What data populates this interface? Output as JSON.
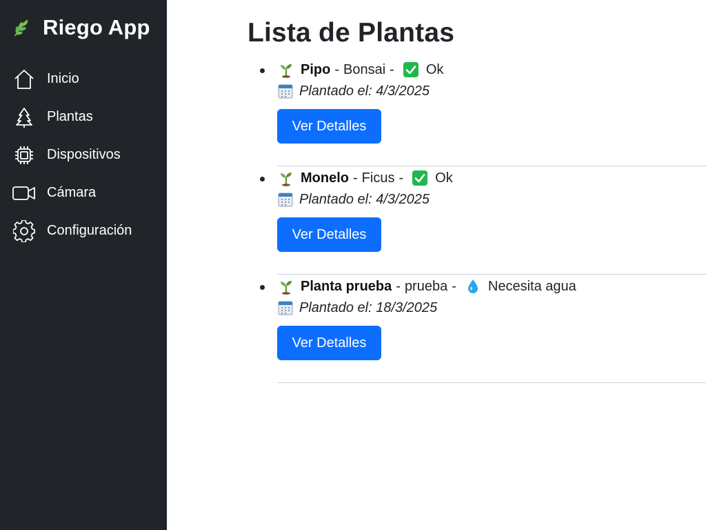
{
  "app": {
    "title": "Riego App",
    "logo_icon": "leaf-icon"
  },
  "sidebar": {
    "items": [
      {
        "label": "Inicio",
        "icon": "house-icon"
      },
      {
        "label": "Plantas",
        "icon": "tree-icon"
      },
      {
        "label": "Dispositivos",
        "icon": "cpu-chip-icon"
      },
      {
        "label": "Cámara",
        "icon": "video-camera-icon"
      },
      {
        "label": "Configuración",
        "icon": "gear-icon"
      }
    ]
  },
  "main": {
    "title": "Lista de Plantas",
    "plants": [
      {
        "name": "Pipo",
        "species": "Bonsai",
        "status": "Ok",
        "status_icon": "check-mark-icon",
        "planted": "Plantado el: 4/3/2025",
        "button": "Ver Detalles"
      },
      {
        "name": "Monelo",
        "species": "Ficus",
        "status": "Ok",
        "status_icon": "check-mark-icon",
        "planted": "Plantado el: 4/3/2025",
        "button": "Ver Detalles"
      },
      {
        "name": "Planta prueba",
        "species": "prueba",
        "status": "Necesita agua",
        "status_icon": "water-drop-icon",
        "planted": "Plantado el: 18/3/2025",
        "button": "Ver Detalles"
      }
    ],
    "separator": "-"
  },
  "colors": {
    "sidebar_bg": "#212529",
    "primary_button": "#0d6efd",
    "check_green": "#1fb84f",
    "drop_blue": "#2aa7e6",
    "leaf_green": "#5cb85c"
  }
}
